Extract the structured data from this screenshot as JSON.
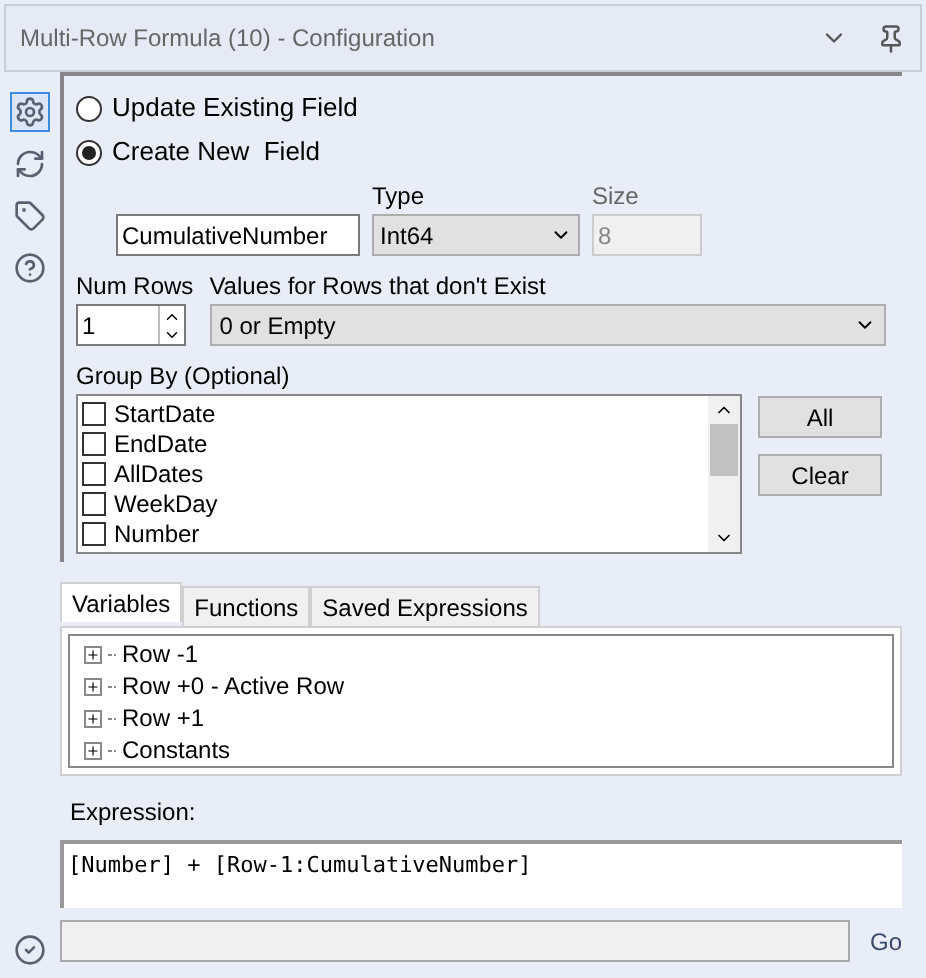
{
  "window": {
    "title": "Multi-Row Formula (10) - Configuration"
  },
  "sidebar": {
    "items": [
      {
        "kind": "gear",
        "selected": true
      },
      {
        "kind": "connect",
        "selected": false
      },
      {
        "kind": "tag",
        "selected": false
      },
      {
        "kind": "help",
        "selected": false
      }
    ]
  },
  "mode": [
    {
      "label": "Update Existing Field",
      "selected": false
    },
    {
      "label": "Create New  Field",
      "selected": true
    }
  ],
  "new_field": {
    "name": "CumulativeNumber",
    "type_label": "Type",
    "type": "Int64",
    "size_label": "Size",
    "size": "8"
  },
  "num_rows": {
    "label": "Num Rows",
    "value": "1"
  },
  "missing": {
    "label": "Values for Rows that don't Exist",
    "value": "0 or Empty"
  },
  "group_by": {
    "label": "Group By (Optional)",
    "items": [
      {
        "label": "StartDate",
        "checked": false
      },
      {
        "label": "EndDate",
        "checked": false
      },
      {
        "label": "AllDates",
        "checked": false
      },
      {
        "label": "WeekDay",
        "checked": false
      },
      {
        "label": "Number",
        "checked": false
      }
    ],
    "buttons": [
      "All",
      "Clear"
    ]
  },
  "tabs": [
    {
      "label": "Variables",
      "selected": true
    },
    {
      "label": "Functions",
      "selected": false
    },
    {
      "label": "Saved Expressions",
      "selected": false
    }
  ],
  "tree": [
    {
      "label": "Row -1",
      "expanded": false
    },
    {
      "label": "Row +0 - Active Row",
      "expanded": false
    },
    {
      "label": "Row +1",
      "expanded": false
    },
    {
      "label": "Constants",
      "expanded": false
    }
  ],
  "expression": {
    "label": "Expression:",
    "value": "[Number] + [Row-1:CumulativeNumber]"
  },
  "status_bar": {
    "go": "Go"
  }
}
